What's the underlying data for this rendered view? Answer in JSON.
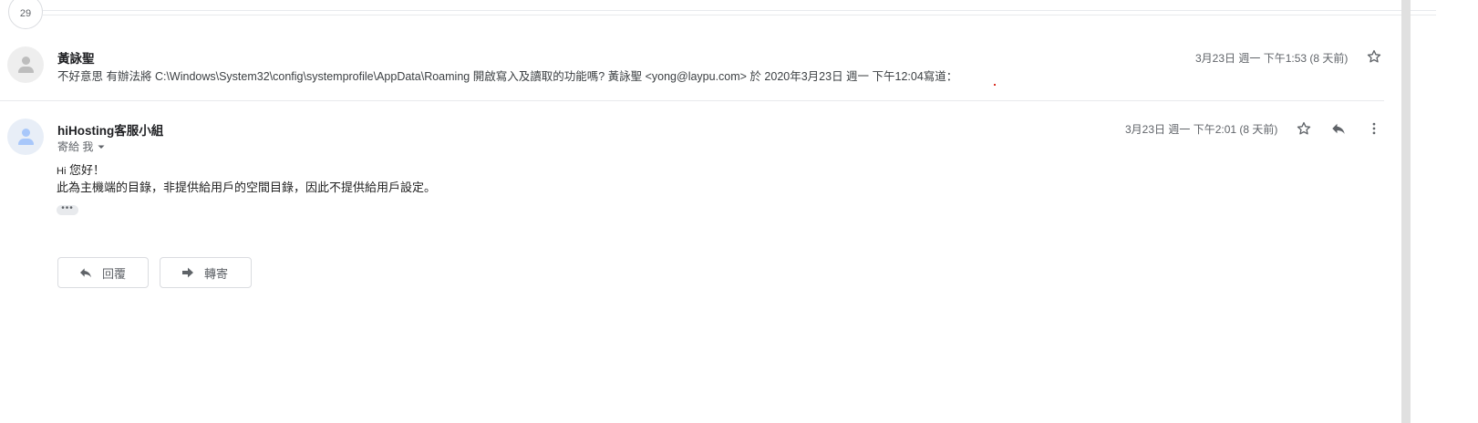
{
  "thread": {
    "collapsed_count": "29"
  },
  "message1": {
    "sender": "黃詠聖",
    "snippet": "不好意思 有辦法將 C:\\Windows\\System32\\config\\systemprofile\\AppData\\Roaming 開啟寫入及讀取的功能嗎? 黃詠聖 <yong@laypu.com> 於 2020年3月23日 週一 下午12:04寫道：",
    "date": "3月23日 週一 下午1:53 (8 天前)",
    "icons": {
      "avatar": "person-avatar",
      "star": "star-icon"
    }
  },
  "message2": {
    "sender": "hiHosting客服小組",
    "to_label": "寄給 我",
    "date": "3月23日 週一 下午2:01 (8 天前)",
    "greeting_prefix": "Hi",
    "greeting": "您好！",
    "body_line": "此為主機端的目錄，非提供給用戶的空間目錄，因此不提供給用戶設定。",
    "trimmed_content": "•••",
    "icons": {
      "avatar": "person-avatar",
      "star": "star-icon",
      "reply": "reply-icon",
      "more": "more-vert-icon"
    }
  },
  "actions": {
    "reply_label": "回覆",
    "forward_label": "轉寄"
  },
  "colors": {
    "accent_red": "#d93025",
    "text_gray": "#5f6368"
  }
}
